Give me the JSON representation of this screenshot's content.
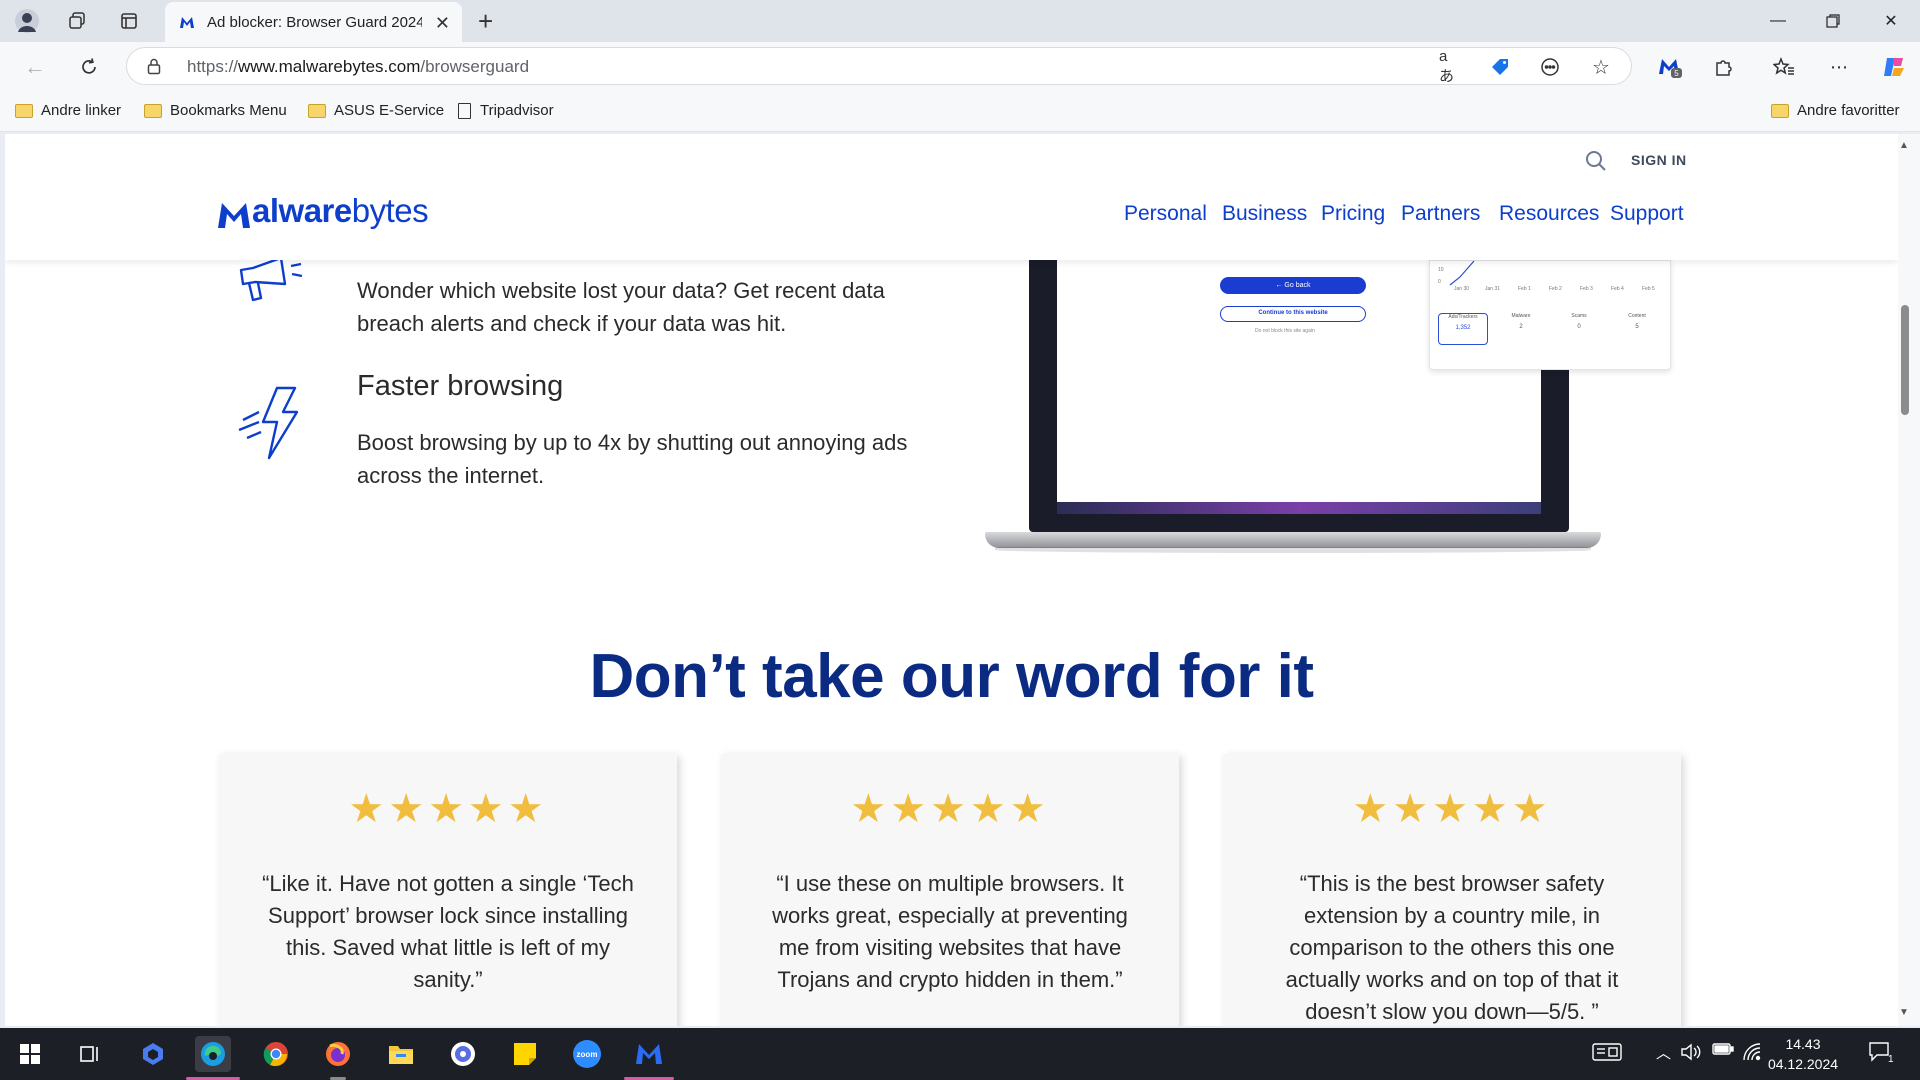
{
  "browser": {
    "tab_title": "Ad blocker: Browser Guard 2024 -",
    "url_prefix": "https://",
    "url_domain": "www.malwarebytes.com",
    "url_path": "/browserguard",
    "translate_label": "aあ",
    "extension_badge": "5",
    "bookmarks": [
      "Andre linker",
      "Bookmarks Menu",
      "ASUS E-Service",
      "Tripadvisor"
    ],
    "other_favorites": "Andre favoritter"
  },
  "header": {
    "signin": "SIGN IN",
    "logo_bold": "alware",
    "logo_light": "bytes",
    "nav": [
      "Personal",
      "Business",
      "Pricing",
      "Partners",
      "Resources",
      "Support"
    ]
  },
  "features": {
    "breach_text": "Wonder which website lost your data? Get recent data breach alerts and check if your data was hit.",
    "faster_title": "Faster browsing",
    "faster_text": "Boost browsing by up to 4x by shutting out annoying ads across the internet."
  },
  "mockup": {
    "go_back": "← Go back",
    "continue": "Continue to this website",
    "dont_block": "Do not block this site again",
    "y_labels": [
      "10",
      "0"
    ],
    "x_labels": [
      "Jan 30",
      "Jan 31",
      "Feb 1",
      "Feb 2",
      "Feb 3",
      "Feb 4",
      "Feb 5"
    ],
    "stats": [
      {
        "label": "Ads/Trackers",
        "value": "1,352"
      },
      {
        "label": "Malware",
        "value": "2"
      },
      {
        "label": "Scams",
        "value": "0"
      },
      {
        "label": "Content",
        "value": "5"
      }
    ]
  },
  "testimonials": {
    "title": "Don’t take our word for it",
    "stars": "★★★★★",
    "quotes": [
      "“Like it. Have not gotten a single ‘Tech Support’ browser lock since installing this. Saved what little is left of my sanity.”",
      "“I use these on multiple browsers. It works great, especially at preventing me from visiting websites that have Trojans and crypto hidden in them.”",
      "“This is the best browser safety extension by a country mile, in comparison to the others this one actually works and on top of that it doesn’t slow you down—5/5. ”"
    ]
  },
  "taskbar": {
    "time": "14.43",
    "date": "04.12.2024",
    "notification_count": "1",
    "zoom_label": "zoom"
  },
  "colors": {
    "brand_blue": "#0d3ecc",
    "heading_navy": "#0b2a82",
    "star_gold": "#f0bd3e"
  }
}
